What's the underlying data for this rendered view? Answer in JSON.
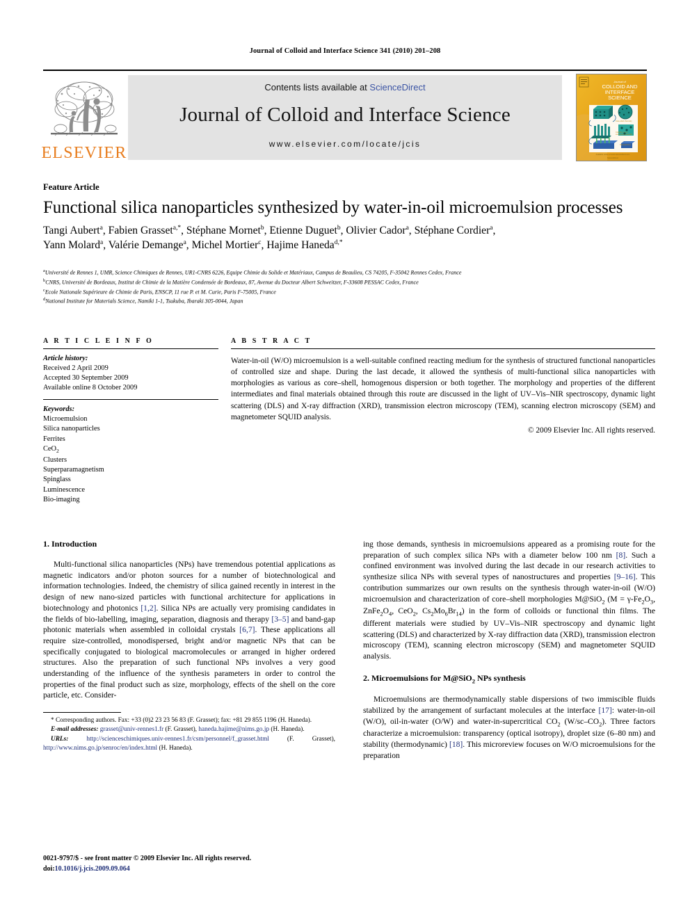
{
  "running_head": "Journal of Colloid and Interface Science 341 (2010) 201–208",
  "masthead": {
    "contents_prefix": "Contents lists available at ",
    "sciencedirect": "ScienceDirect",
    "journal_title": "Journal of Colloid and Interface Science",
    "journal_url": "www.elsevier.com/locate/jcis",
    "publisher_wordmark": "ELSEVIER",
    "publisher_color": "#E87D1E",
    "link_color": "#3a53a4",
    "banner_bg": "#e3e3e3",
    "cover_bg": "#E8A61C",
    "cover_title_line1": "Journal of",
    "cover_title_line2": "COLLOID AND",
    "cover_title_line3": "INTERFACE",
    "cover_title_line4": "SCIENCE"
  },
  "article": {
    "type_label": "Feature Article",
    "title": "Functional silica nanoparticles synthesized by water-in-oil microemulsion processes",
    "authors_line1": "Tangi Aubert<sup>a</sup>, Fabien Grasset<sup>a,*</sup>, Stéphane Mornet<sup>b</sup>, Etienne Duguet<sup>b</sup>, Olivier Cador<sup>a</sup>, Stéphane Cordier<sup>a</sup>,",
    "authors_line2": "Yann Molard<sup>a</sup>, Valérie Demange<sup>a</sup>, Michel Mortier<sup>c</sup>, Hajime Haneda<sup>d,*</sup>",
    "affiliations": [
      "<sup>a</sup>Université de Rennes 1, UMR, Science Chimiques de Rennes, UR1-CNRS 6226, Equipe Chimie du Solide et Matériaux, Campus de Beaulieu, CS 74205, F-35042 Rennes Cedex, France",
      "<sup>b</sup>CNRS, Université de Bordeaux, Institut de Chimie de la Matière Condensée de Bordeaux, 87, Avenue du Docteur Albert Schweitzer, F-33608 PESSAC Cedex, France",
      "<sup>c</sup>Ecole Nationale Supérieure de Chimie de Paris, ENSCP, 11 rue P. et M. Curie, Paris F-75005, France",
      "<sup>d</sup>National Institute for Materials Science, Namiki 1-1, Tsukuba, Ibaraki 305-0044, Japan"
    ]
  },
  "info": {
    "heading": "A R T I C L E    I N F O",
    "history_label": "Article history:",
    "history": [
      "Received 2 April 2009",
      "Accepted 30 September 2009",
      "Available online 8 October 2009"
    ],
    "keywords_label": "Keywords:",
    "keywords": [
      "Microemulsion",
      "Silica nanoparticles",
      "Ferrites",
      "CeO<sub>2</sub>",
      "Clusters",
      "Superparamagnetism",
      "Spinglass",
      "Luminescence",
      "Bio-imaging"
    ]
  },
  "abstract": {
    "heading": "A B S T R A C T",
    "text": "Water-in-oil (W/O) microemulsion is a well-suitable confined reacting medium for the synthesis of structured functional nanoparticles of controlled size and shape. During the last decade, it allowed the synthesis of multi-functional silica nanoparticles with morphologies as various as core–shell, homogenous dispersion or both together. The morphology and properties of the different intermediates and final materials obtained through this route are discussed in the light of UV–Vis–NIR spectroscopy, dynamic light scattering (DLS) and X-ray diffraction (XRD), transmission electron microscopy (TEM), scanning electron microscopy (SEM) and magnetometer SQUID analysis.",
    "copyright": "© 2009 Elsevier Inc. All rights reserved."
  },
  "sections": {
    "intro_heading": "1. Introduction",
    "intro_para": "Multi-functional silica nanoparticles (NPs) have tremendous potential applications as magnetic indicators and/or photon sources for a number of biotechnological and information technologies. Indeed, the chemistry of silica gained recently in interest in the design of new nano-sized particles with functional architecture for applications in biotechnology and photonics <span class=\"ref\">[1,2]</span>. Silica NPs are actually very promising candidates in the fields of bio-labelling, imaging, separation, diagnosis and therapy <span class=\"ref\">[3–5]</span> and band-gap photonic materials when assembled in colloidal crystals <span class=\"ref\">[6,7]</span>. These applications all require size-controlled, monodispersed, bright and/or magnetic NPs that can be specifically conjugated to biological macromolecules or arranged in higher ordered structures. Also the preparation of such functional NPs involves a very good understanding of the influence of the synthesis parameters in order to control the properties of the final product such as size, morphology, effects of the shell on the core particle, etc. Consider-",
    "intro_cont": "ing those demands, synthesis in microemulsions appeared as a promising route for the preparation of such complex silica NPs with a diameter below 100 nm <span class=\"ref\">[8]</span>. Such a confined environment was involved during the last decade in our research activities to synthesize silica NPs with several types of nanostructures and properties <span class=\"ref\">[9–16]</span>. This contribution summarizes our own results on the synthesis through water-in-oil (W/O) microemulsion and characterization of core–shell morphologies M@SiO<sub>2</sub> (M = γ-Fe<sub>2</sub>O<sub>3</sub>, ZnFe<sub>2</sub>O<sub>4</sub>, CeO<sub>2</sub>, Cs<sub>2</sub>Mo<sub>6</sub>Br<sub>14</sub>) in the form of colloids or functional thin films. The different materials were studied by UV–Vis–NIR spectroscopy and dynamic light scattering (DLS) and characterized by X-ray diffraction data (XRD), transmission electron microscopy (TEM), scanning electron microscopy (SEM) and magnetometer SQUID analysis.",
    "sec2_heading": "2. Microemulsions for M@SiO<sub>2</sub> NPs synthesis",
    "sec2_para": "Microemulsions are thermodynamically stable dispersions of two immiscible fluids stabilized by the arrangement of surfactant molecules at the interface <span class=\"ref\">[17]</span>: water-in-oil (W/O), oil-in-water (O/W) and water-in-supercritical CO<sub>2</sub> (W/sc–CO<sub>2</sub>). Three factors characterize a microemulsion: transparency (optical isotropy), droplet size (6–80 nm) and stability (thermodynamic) <span class=\"ref\">[18]</span>. This microreview focuses on W/O microemulsions for the preparation"
  },
  "footnotes": {
    "corresponding": "* Corresponding authors. Fax: +33 (0)2 23 23 56 83 (F. Grasset); fax: +81 29 855 1196 (H. Haneda).",
    "email_label": "E-mail addresses:",
    "email_text": " <span class=\"lnk\">grasset@univ-rennes1.fr</span> (F. Grasset), <span class=\"lnk\">haneda.hajime@nims.go.jp</span> (H. Haneda).",
    "urls_label": "URLs:",
    "urls_text": " <span class=\"lnk\">http://scienceschimiques.univ-rennes1.fr/csm/personnel/f_grasset.html</span> (F. Grasset), <span class=\"lnk\">http://www.nims.go.jp/senroc/en/index.html</span> (H. Haneda)."
  },
  "imprint": {
    "line1": "0021-9797/$ - see front matter © 2009 Elsevier Inc. All rights reserved.",
    "doi_label": "doi:",
    "doi": "10.1016/j.jcis.2009.09.064"
  }
}
